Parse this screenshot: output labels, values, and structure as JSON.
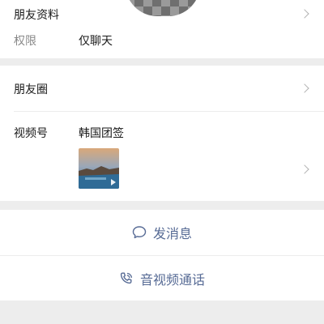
{
  "profile": {
    "section_label": "朋友资料",
    "permission_label": "权限",
    "permission_value": "仅聊天"
  },
  "moments": {
    "label": "朋友圈"
  },
  "channels": {
    "label": "视频号",
    "channel_name": "韩国团签",
    "thumbnail_icon": "play-icon"
  },
  "actions": {
    "message_label": "发消息",
    "message_icon": "chat-bubble-icon",
    "call_label": "音视频通话",
    "call_icon": "phone-call-icon"
  },
  "colors": {
    "link": "#576b95",
    "background": "#ededed",
    "card": "#ffffff"
  }
}
